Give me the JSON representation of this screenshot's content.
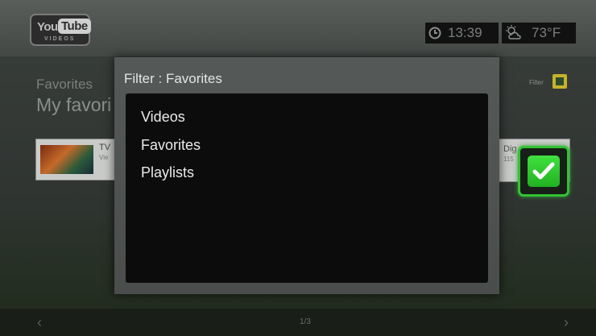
{
  "logo": {
    "you": "You",
    "tube": "Tube",
    "subtitle": "VIDEOS"
  },
  "status": {
    "time": "13:39",
    "temperature": "73°F",
    "clock_icon": "clock-icon",
    "weather_icon": "partly-cloudy-icon"
  },
  "background": {
    "header": "Favorites",
    "subheader": "My favori",
    "filter_label": "Filter",
    "left_item": {
      "title": "TV",
      "subtitle": "Vie"
    },
    "right_item": {
      "title": "Dig",
      "subtitle": "115"
    },
    "page_indicator": "1/3",
    "nav_left": "‹",
    "nav_right": "›"
  },
  "dialog": {
    "title": "Filter : Favorites",
    "options": [
      "Videos",
      "Favorites",
      "Playlists"
    ]
  },
  "colors": {
    "accent_green": "#33c233",
    "filter_badge": "#c7b12c"
  }
}
